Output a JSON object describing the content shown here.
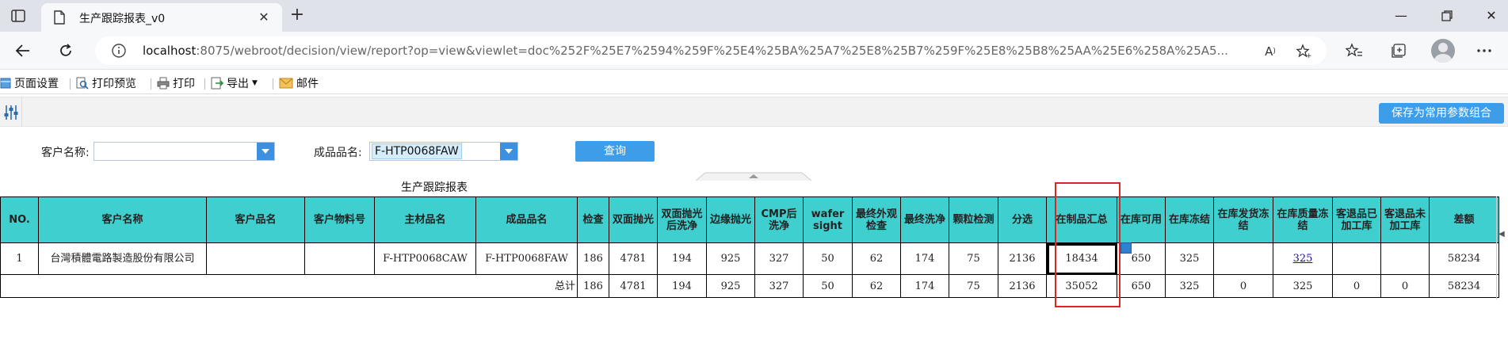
{
  "browser": {
    "tab_title": "生产跟踪报表_v0",
    "url_host": "localhost",
    "url_rest": ":8075/webroot/decision/view/report?op=view&viewlet=doc%252F%25E7%2594%259F%25E4%25BA%25A7%25E8%25B7%259F%25E8%25B8%25AA%25E6%258A%25A5..."
  },
  "toolbar": {
    "page_setup": "页面设置",
    "print_preview": "打印预览",
    "print": "打印",
    "export": "导出",
    "mail": "邮件"
  },
  "params": {
    "save_button": "保存为常用参数组合",
    "customer_label": "客户名称:",
    "customer_value": "",
    "product_label": "成品品名:",
    "product_value": "F-HTP0068FAW",
    "query_button": "查询"
  },
  "report": {
    "title": "生产跟踪报表",
    "headers": [
      "NO.",
      "客户名称",
      "客户品名",
      "客户物料号",
      "主材品名",
      "成品品名",
      "检查",
      "双面抛光",
      "双面抛光后洗净",
      "边缘抛光",
      "CMP后洗净",
      "wafer sight",
      "最终外观检查",
      "最终洗净",
      "颗粒检测",
      "分选",
      "在制品汇总",
      "在库可用",
      "在库冻结",
      "在库发货冻结",
      "在库质量冻结",
      "客退品已加工库",
      "客退品未加工库",
      "差额"
    ],
    "rows": [
      [
        "1",
        "台灣積體電路製造股份有限公司",
        "",
        "",
        "F-HTP0068CAW",
        "F-HTP0068FAW",
        "186",
        "4781",
        "194",
        "925",
        "327",
        "50",
        "62",
        "174",
        "75",
        "2136",
        "18434",
        "650",
        "325",
        "",
        "325",
        "",
        "",
        "58234"
      ]
    ],
    "total_label": "总计",
    "totals": [
      "186",
      "4781",
      "194",
      "925",
      "327",
      "50",
      "62",
      "174",
      "75",
      "2136",
      "35052",
      "650",
      "325",
      "0",
      "325",
      "0",
      "0",
      "58234"
    ]
  }
}
